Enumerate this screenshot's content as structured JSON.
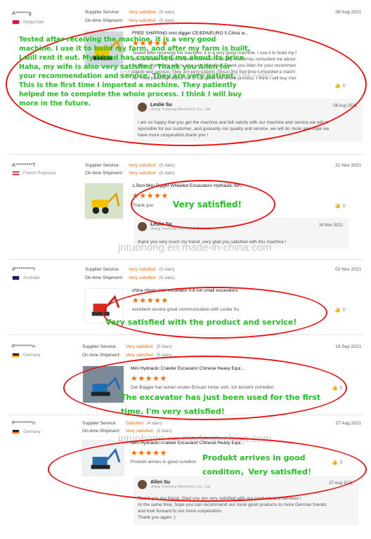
{
  "labels": {
    "supplier_service": "Supplier Service:",
    "ontime_shipment": "On-time Shipment:"
  },
  "watermark": "jntuohong.en.made-in-china.com",
  "reviews": [
    {
      "buyer": "A*******g",
      "country": "Kyrgyzstan",
      "supplier_val": "Very satisfied",
      "supplier_stars": "(5 stars)",
      "shipment_val": "Very satisfied",
      "shipment_stars": "(5 stars)",
      "date": "08 Aug 2021",
      "product": "FREE SHIPPING mini digger CE/EPA/EURO 5 China w...",
      "stars": "★★★★★",
      "text_lines": [
        "Tested after receiving the machine, it is a very good machine. I use it to build my f",
        "arm, and after my farm is built, I will rent it out. My friend has consulted me about",
        "its price. Haha, my wife is also very satisfied. Thank you Allen for your recommen",
        "dation and service. They are very patient. This is the first time I imported a machi",
        "ne. They patiently helped me to complete the whole process. I think I will buy mor"
      ],
      "likes": "0",
      "reply": {
        "name": "Leslie Su",
        "company": "Jining Tuohong Machinery Co., Ltd.",
        "date": "08 Aug 2021",
        "text_lines": [
          "I am so happy that you get the machine and felt satisfy with our machine and service,we will re",
          "sponsible for our customer ,and guaranty our quality and service. we will do more and hope we",
          "have more cooperation,thank you !"
        ]
      },
      "annotation_lines": [
        "Tested after receiving the machine, it is a very good",
        "machine. I use it to build my farm, and after my farm is built,",
        "I will rent it out. My friend has consulted me about its price.",
        "Haha, my wife is also very satisfied. Thank you Allen for",
        "your recommendation and service. They are very patient.",
        "This is the first time I imported a machine. They patiently",
        "helped me to complete the whole process. I think I will buy",
        "more in the future."
      ]
    },
    {
      "buyer": "A*********T",
      "country": "French Polynesia",
      "supplier_val": "Very satisfied",
      "supplier_stars": "(5 stars)",
      "shipment_val": "Very satisfied",
      "shipment_stars": "(5 stars)",
      "date": "21 Nov 2021",
      "product": "1.5ton Mini Digger Wheeled Excavators Hydraulic Wh...",
      "stars": "★★★★★",
      "text": "Thank you",
      "likes": "0",
      "reply": {
        "name": "Leslie Su",
        "company": "Jining Tuohong Machinery Co., Ltd",
        "date": "24 Nov 2021",
        "text_lines": [
          "thank you very much my friend ,very glad you satisfied with this machine !"
        ]
      },
      "annotation": "Very satisfied!"
    },
    {
      "buyer": "d**********r",
      "country": "Australia",
      "supplier_val": "Very satisfied",
      "supplier_stars": "(5 stars)",
      "shipment_val": "Very satisfied",
      "shipment_stars": "(5 stars)",
      "date": "02 Nov 2021",
      "product": "china cheap mini excavator 0.8 ton small excavators",
      "stars": "★★★★★",
      "text": "excellent service great communication with Leslie Su",
      "likes": "0",
      "annotation": "Very satisfied with the product and service!"
    },
    {
      "buyer": "P*********n",
      "country": "Germany",
      "supplier_val": "Very satisfied",
      "supplier_stars": "(5 stars)",
      "shipment_val": "Very satisfied",
      "shipment_stars": "(5 stars)",
      "date": "19 Sep 2021",
      "product": "Mini Hydraulic Crawler Excavator Chinese Heavy Equi...",
      "stars": "★★★★★",
      "text": "Der Bagger hat seinen ersten Einsatz hinter sich. Ich binsehr zufrieden.",
      "likes": "0",
      "annotation_lines": [
        "The excavator has just been used for the first",
        "time. I'm very satisfied!"
      ]
    },
    {
      "buyer": "P*********n",
      "country": "Germany",
      "supplier_val": "Satisfied",
      "supplier_stars": "(4 stars)",
      "shipment_val": "Very satisfied",
      "shipment_stars": "(5 stars)",
      "date": "27 Aug 2021",
      "product": "Mini Hydraulic Crawler Excavator Chinese Heavy Equi...",
      "stars": "★★★★★",
      "text": "Produkt arrives in good conditon",
      "likes": "0",
      "reply": {
        "name": "Allen Su",
        "company": "Jining Tuohong Machinery Co., Ltd.",
        "date": "27 Aug 2021",
        "text_lines": [
          "Thank you my friend, Glad you are very satisfied with our products and services !",
          "At the same time, hope you can recommend our more good products to more German friends",
          "and look forward to our more cooperation.",
          "Thank you again :)"
        ]
      },
      "annotation_lines": [
        "Produkt arrives in good",
        "conditon，Very satisfied！"
      ]
    }
  ]
}
